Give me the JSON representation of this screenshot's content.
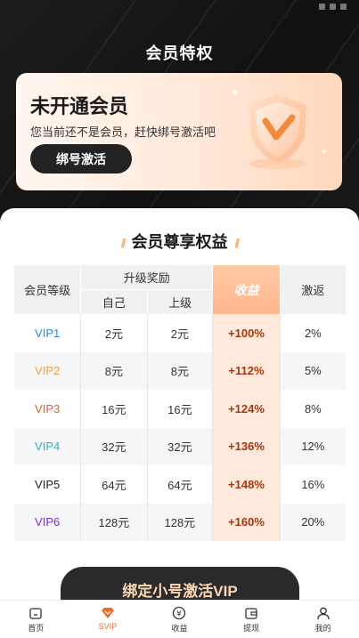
{
  "header": {
    "title": "会员特权"
  },
  "member_card": {
    "status": "未开通会员",
    "description": "您当前还不是会员，赶快绑号激活吧",
    "button_label": "绑号激活"
  },
  "benefits": {
    "title": "会员尊享权益",
    "table": {
      "col_level": "会员等级",
      "col_upgrade": "升级奖励",
      "col_self": "自己",
      "col_parent": "上级",
      "col_profit": "收益",
      "col_rebate": "激返",
      "rows": [
        {
          "level": "VIP1",
          "self": "2元",
          "parent": "2元",
          "profit": "+100%",
          "rebate": "2%",
          "color": "#2a8fd8"
        },
        {
          "level": "VIP2",
          "self": "8元",
          "parent": "8元",
          "profit": "+112%",
          "rebate": "5%",
          "color": "#f0a03c"
        },
        {
          "level": "VIP3",
          "self": "16元",
          "parent": "16元",
          "profit": "+124%",
          "rebate": "8%",
          "color": "#f05a28"
        },
        {
          "level": "VIP4",
          "self": "32元",
          "parent": "32元",
          "profit": "+136%",
          "rebate": "12%",
          "color": "#22b8c8"
        },
        {
          "level": "VIP5",
          "self": "64元",
          "parent": "64元",
          "profit": "+148%",
          "rebate": "16%",
          "color": "#222222"
        },
        {
          "level": "VIP6",
          "self": "128元",
          "parent": "128元",
          "profit": "+160%",
          "rebate": "20%",
          "color": "#7a2ee0"
        }
      ]
    }
  },
  "cta_label": "绑定小号激活VIP",
  "tabbar": {
    "items": [
      {
        "label": "首页",
        "icon": "home-icon"
      },
      {
        "label": "SVIP",
        "icon": "diamond-icon"
      },
      {
        "label": "收益",
        "icon": "yen-coin-icon"
      },
      {
        "label": "提现",
        "icon": "wallet-icon"
      },
      {
        "label": "我的",
        "icon": "user-icon"
      }
    ],
    "active_index": 1,
    "active_color": "#f06a2a"
  }
}
